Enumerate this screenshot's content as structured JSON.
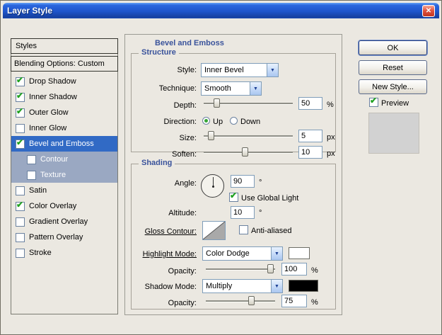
{
  "window": {
    "title": "Layer Style",
    "close_icon": "✕"
  },
  "sidebar": {
    "header": "Styles",
    "blending_options": "Blending Options: Custom",
    "items": [
      {
        "label": "Drop Shadow",
        "checked": true,
        "selected": false,
        "sub": false,
        "subselected": false
      },
      {
        "label": "Inner Shadow",
        "checked": true,
        "selected": false,
        "sub": false,
        "subselected": false
      },
      {
        "label": "Outer Glow",
        "checked": true,
        "selected": false,
        "sub": false,
        "subselected": false
      },
      {
        "label": "Inner Glow",
        "checked": false,
        "selected": false,
        "sub": false,
        "subselected": false
      },
      {
        "label": "Bevel and Emboss",
        "checked": true,
        "selected": true,
        "sub": false,
        "subselected": false
      },
      {
        "label": "Contour",
        "checked": false,
        "selected": false,
        "sub": true,
        "subselected": true
      },
      {
        "label": "Texture",
        "checked": false,
        "selected": false,
        "sub": true,
        "subselected": true
      },
      {
        "label": "Satin",
        "checked": false,
        "selected": false,
        "sub": false,
        "subselected": false
      },
      {
        "label": "Color Overlay",
        "checked": true,
        "selected": false,
        "sub": false,
        "subselected": false
      },
      {
        "label": "Gradient Overlay",
        "checked": false,
        "selected": false,
        "sub": false,
        "subselected": false
      },
      {
        "label": "Pattern Overlay",
        "checked": false,
        "selected": false,
        "sub": false,
        "subselected": false
      },
      {
        "label": "Stroke",
        "checked": false,
        "selected": false,
        "sub": false,
        "subselected": false
      }
    ]
  },
  "panel": {
    "title": "Bevel and Emboss",
    "structure": {
      "legend": "Structure",
      "style_label": "Style:",
      "style_value": "Inner Bevel",
      "technique_label": "Technique:",
      "technique_value": "Smooth",
      "depth_label": "Depth:",
      "depth_value": "50",
      "depth_unit": "%",
      "depth_percent": 14,
      "direction_label": "Direction:",
      "direction_up": "Up",
      "direction_down": "Down",
      "direction_up_selected": true,
      "direction_down_selected": false,
      "size_label": "Size:",
      "size_value": "5",
      "size_unit": "px",
      "size_percent": 8,
      "soften_label": "Soften:",
      "soften_value": "10",
      "soften_unit": "px",
      "soften_percent": 46
    },
    "shading": {
      "legend": "Shading",
      "angle_label": "Angle:",
      "angle_value": "90",
      "angle_unit": "°",
      "use_global_light_label": "Use Global Light",
      "use_global_light_checked": true,
      "altitude_label": "Altitude:",
      "altitude_value": "10",
      "altitude_unit": "°",
      "gloss_contour_label": "Gloss Contour:",
      "anti_aliased_label": "Anti-aliased",
      "anti_aliased_checked": false,
      "highlight_mode_label": "Highlight Mode:",
      "highlight_mode_value": "Color Dodge",
      "highlight_swatch_color": "#ffffff",
      "highlight_opacity_label": "Opacity:",
      "highlight_opacity_value": "100",
      "highlight_opacity_unit": "%",
      "highlight_opacity_percent": 93,
      "shadow_mode_label": "Shadow Mode:",
      "shadow_mode_value": "Multiply",
      "shadow_swatch_color": "#000000",
      "shadow_opacity_label": "Opacity:",
      "shadow_opacity_value": "75",
      "shadow_opacity_unit": "%",
      "shadow_opacity_percent": 65
    }
  },
  "actions": {
    "ok": "OK",
    "reset": "Reset",
    "new_style": "New Style...",
    "preview_label": "Preview",
    "preview_checked": true
  },
  "colors": {
    "selection": "#316ac5",
    "sub_selection": "#9aa8c2",
    "heading": "#3a539b",
    "preview_bg": "#d2d2d2"
  }
}
